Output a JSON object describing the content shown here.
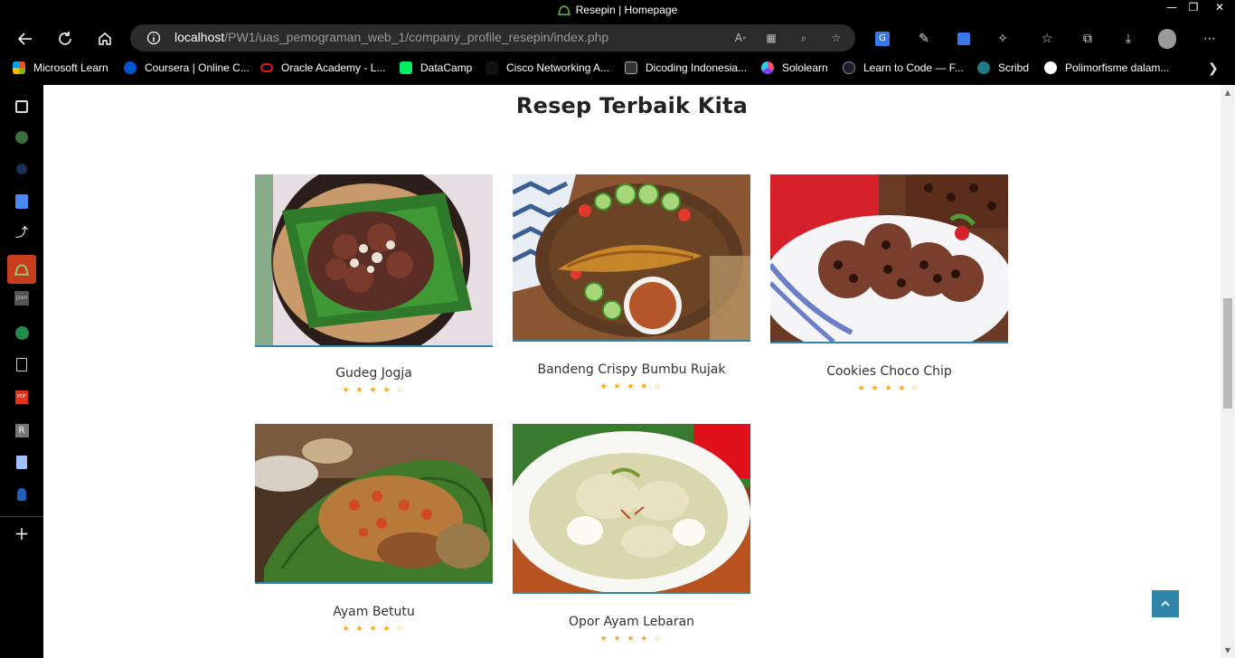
{
  "window": {
    "title": "Resepin | Homepage"
  },
  "address": {
    "host": "localhost",
    "path": "/PW1/uas_pemograman_web_1/company_profile_resepin/index.php"
  },
  "bookmarks": [
    {
      "label": "Microsoft Learn",
      "icon": "microsoft-icon"
    },
    {
      "label": "Coursera | Online C...",
      "icon": "coursera-icon"
    },
    {
      "label": "Oracle Academy - L...",
      "icon": "oracle-icon"
    },
    {
      "label": "DataCamp",
      "icon": "datacamp-icon"
    },
    {
      "label": "Cisco Networking A...",
      "icon": "cisco-icon"
    },
    {
      "label": "Dicoding Indonesia...",
      "icon": "dicoding-icon"
    },
    {
      "label": "Sololearn",
      "icon": "sololearn-icon"
    },
    {
      "label": "Learn to Code — F...",
      "icon": "freecodecamp-icon"
    },
    {
      "label": "Scribd",
      "icon": "scribd-icon"
    },
    {
      "label": "Polimorfisme dalam...",
      "icon": "google-icon"
    }
  ],
  "page": {
    "section_title": "Resep Terbaik Kita",
    "recipes": [
      {
        "name": "Gudeg Jogja",
        "rating": 4,
        "stars": "★ ★ ★ ★ ☆"
      },
      {
        "name": "Bandeng Crispy Bumbu Rujak",
        "rating": 4,
        "stars": "★ ★ ★ ★ ☆"
      },
      {
        "name": "Cookies Choco Chip",
        "rating": 4,
        "stars": "★ ★ ★ ★ ☆"
      },
      {
        "name": "Ayam Betutu",
        "rating": 4,
        "stars": "★ ★ ★ ★ ☆"
      },
      {
        "name": "Opor Ayam Lebaran",
        "rating": 4,
        "stars": "★ ★ ★ ★ ☆"
      }
    ]
  },
  "colors": {
    "accent": "#2f86a8",
    "star": "#f5a623",
    "chrome_bg": "#000000",
    "address_bg": "#2b2b2b"
  }
}
